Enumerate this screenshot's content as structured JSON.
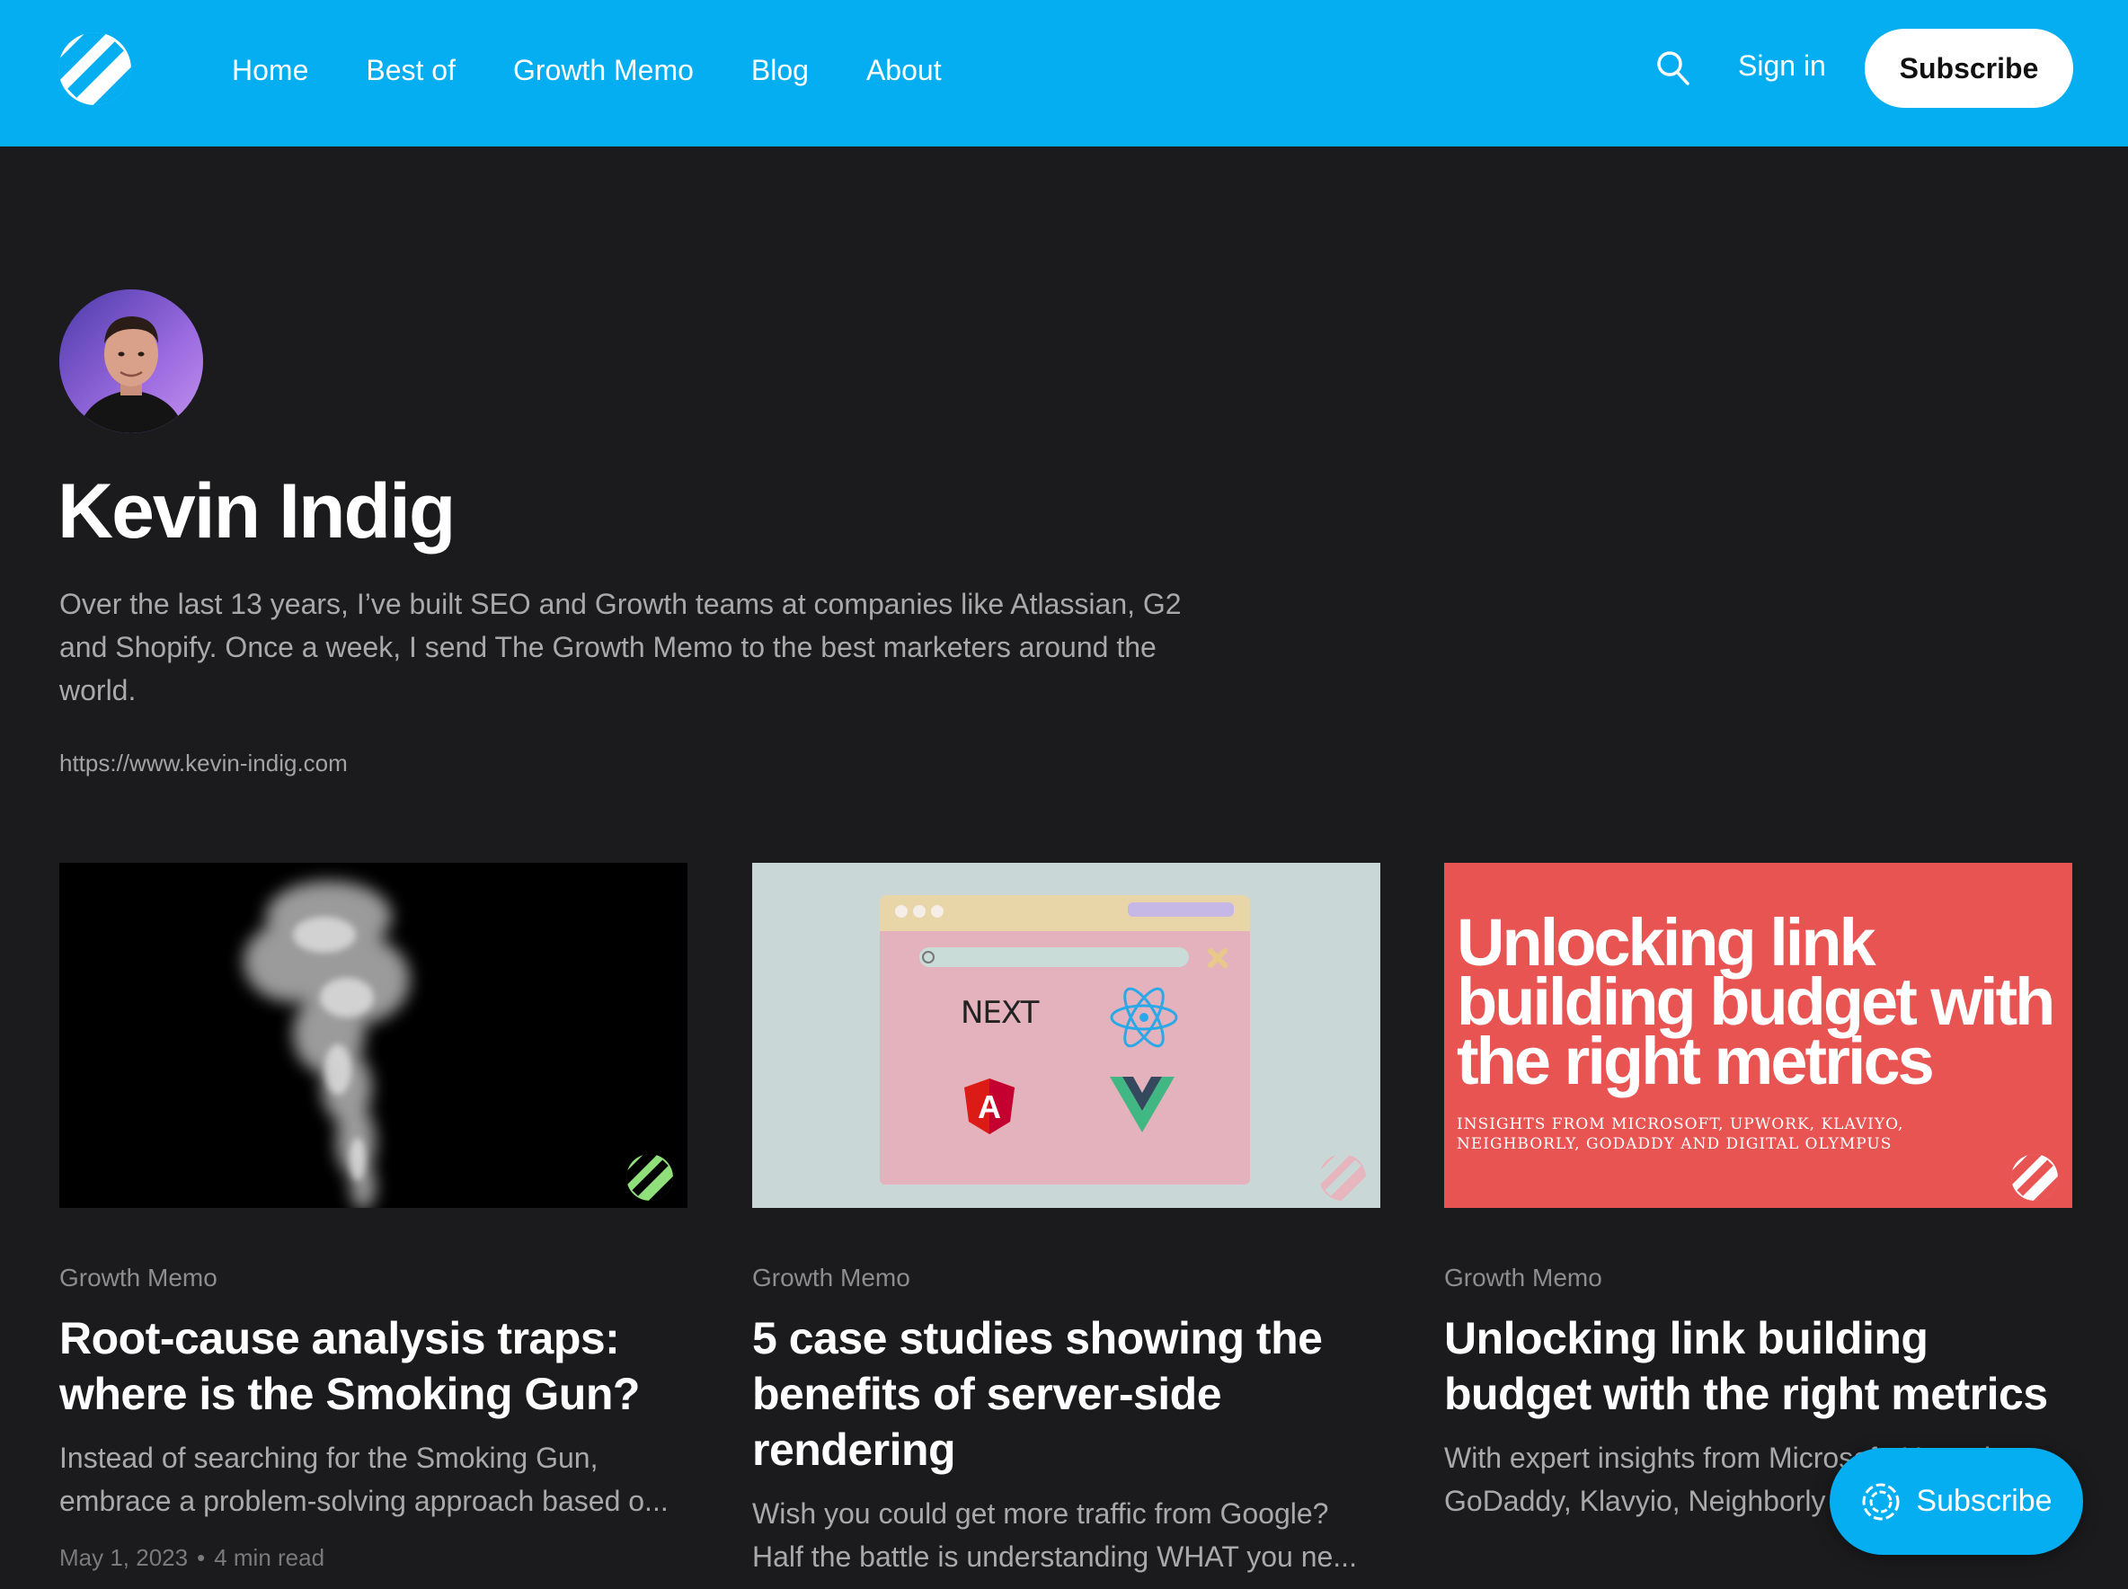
{
  "header": {
    "nav": [
      "Home",
      "Best of",
      "Growth Memo",
      "Blog",
      "About"
    ],
    "signin_label": "Sign in",
    "subscribe_label": "Subscribe",
    "search_icon": "search-icon",
    "brand_color": "#04aef1"
  },
  "author": {
    "name": "Kevin Indig",
    "bio": "Over the last 13 years, I’ve built SEO and Growth teams at companies like Atlassian, G2 and Shopify. Once a week, I send The Growth Memo to the best marketers around the world.",
    "url": "https://www.kevin-indig.com"
  },
  "posts": [
    {
      "tag": "Growth Memo",
      "title": "Root-cause analysis traps: where is the Smoking Gun?",
      "excerpt": "Instead of searching for the Smoking Gun, embrace a problem-solving approach based o...",
      "date": "May 1, 2023",
      "read_time": "4 min read"
    },
    {
      "tag": "Growth Memo",
      "title": "5 case studies showing the benefits of server-side rendering",
      "excerpt": "Wish you could get more traffic from Google? Half the battle is understanding WHAT you ne...",
      "image_labels": {
        "next": "NEXT",
        "angular": "A"
      }
    },
    {
      "tag": "Growth Memo",
      "title": "Unlocking link building budget with the right metrics",
      "excerpt": "With expert insights from Microsoft, Upwork, GoDaddy, Klavyio, Neighborly and Digital...",
      "image_title": "Unlocking link building budget with the right metrics",
      "image_subtitle": "Insights from Microsoft, Upwork, Klaviyo, Neighborly, GoDaddy and Digital Olympus"
    }
  ],
  "floating": {
    "subscribe_label": "Subscribe"
  }
}
